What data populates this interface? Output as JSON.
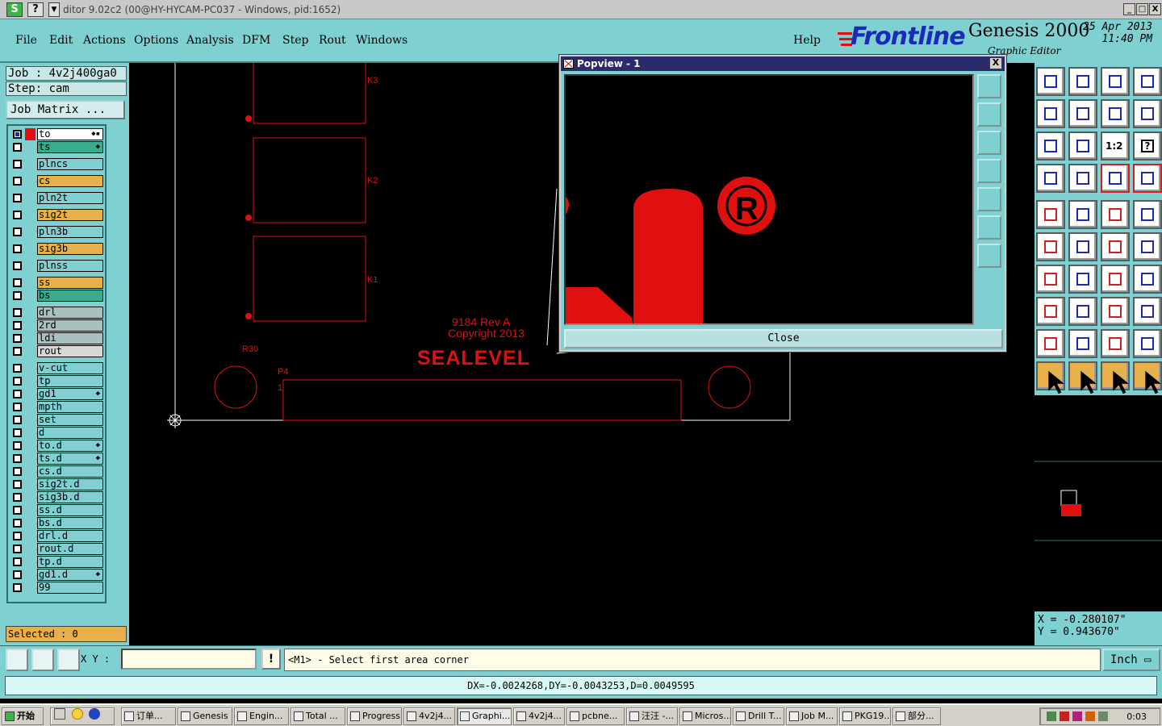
{
  "window": {
    "title": "ditor 9.02c2 (00@HY-HYCAM-PC037 - Windows, pid:1652)",
    "icon_label": "S",
    "help_glyph": "?",
    "min": "_",
    "max": "□",
    "close": "X"
  },
  "menu": {
    "items": [
      "File",
      "Edit",
      "Actions",
      "Options",
      "Analysis",
      "DFM",
      "Step",
      "Rout",
      "Windows"
    ],
    "help": "Help"
  },
  "brand": {
    "logo": "Frontline",
    "product": "Genesis 2000",
    "subtitle": "Graphic Editor",
    "date": "25 Apr 2013",
    "time": "11:40 PM"
  },
  "left": {
    "job": "Job : 4v2j400ga0",
    "step": "Step: cam",
    "job_matrix": "Job Matrix ...",
    "selected": "Selected : 0",
    "layers": [
      {
        "name": "to",
        "color": "#ffffff",
        "arrow": "◆▪",
        "red": true,
        "active": true
      },
      {
        "name": "ts",
        "color": "#3caa8c",
        "arrow": "◆"
      },
      {
        "name": "plncs",
        "color": "#7fd0d0"
      },
      {
        "name": "cs",
        "color": "#e8b04a"
      },
      {
        "name": "pln2t",
        "color": "#7fd0d0"
      },
      {
        "name": "sig2t",
        "color": "#e8b04a"
      },
      {
        "name": "pln3b",
        "color": "#7fd0d0"
      },
      {
        "name": "sig3b",
        "color": "#e8b04a"
      },
      {
        "name": "plnss",
        "color": "#7fd0d0"
      },
      {
        "name": "ss",
        "color": "#e8b04a"
      },
      {
        "name": "bs",
        "color": "#3caa8c"
      },
      {
        "name": "drl",
        "color": "#a8c0c0"
      },
      {
        "name": "2rd",
        "color": "#a8c0c0"
      },
      {
        "name": "ldi",
        "color": "#a8c0c0"
      },
      {
        "name": "rout",
        "color": "#d8d8d8"
      },
      {
        "name": "v-cut",
        "color": "#7fd0d0"
      },
      {
        "name": "tp",
        "color": "#7fd0d0"
      },
      {
        "name": "gd1",
        "color": "#7fd0d0",
        "arrow": "◆"
      },
      {
        "name": "mpth",
        "color": "#7fd0d0"
      },
      {
        "name": "set",
        "color": "#7fd0d0"
      },
      {
        "name": "d",
        "color": "#7fd0d0"
      },
      {
        "name": "to.d",
        "color": "#7fd0d0",
        "arrow": "◆"
      },
      {
        "name": "ts.d",
        "color": "#7fd0d0",
        "arrow": "◆"
      },
      {
        "name": "cs.d",
        "color": "#7fd0d0"
      },
      {
        "name": "sig2t.d",
        "color": "#7fd0d0"
      },
      {
        "name": "sig3b.d",
        "color": "#7fd0d0"
      },
      {
        "name": "ss.d",
        "color": "#7fd0d0"
      },
      {
        "name": "bs.d",
        "color": "#7fd0d0"
      },
      {
        "name": "drl.d",
        "color": "#7fd0d0"
      },
      {
        "name": "rout.d",
        "color": "#7fd0d0"
      },
      {
        "name": "tp.d",
        "color": "#7fd0d0"
      },
      {
        "name": "gd1.d",
        "color": "#7fd0d0",
        "arrow": "◆"
      },
      {
        "name": "99",
        "color": "#7fd0d0"
      }
    ]
  },
  "canvas": {
    "labels": {
      "k3": "K3",
      "k2": "K2",
      "k1": "K1",
      "r30": "R30",
      "p4": "P4",
      "pin1": "1",
      "rev": "9184 Rev A",
      "copyright": "Copyright 2013",
      "logo": "SEALEVEL"
    },
    "trace_color": "#e01010"
  },
  "popview": {
    "title": "Popview - 1",
    "close_label": "Close",
    "close_glyph": "X",
    "registered": "R"
  },
  "right": {
    "tool_1_2": "1:2",
    "tool_help": "?",
    "x": "X = -0.280107\"",
    "y": "Y = 0.943670\""
  },
  "cmd": {
    "xy_label": "X Y :",
    "xy_value": "",
    "excl": "!",
    "prompt": "<M1> - Select first area corner",
    "unit": "Inch ▭"
  },
  "status": {
    "text": "DX=-0.0024268,DY=-0.0043253,D=0.0049595"
  },
  "taskbar": {
    "start": "开始",
    "items": [
      {
        "label": "订单..."
      },
      {
        "label": "Genesis"
      },
      {
        "label": "Engin..."
      },
      {
        "label": "Total ..."
      },
      {
        "label": "Progress"
      },
      {
        "label": "4v2j4..."
      },
      {
        "label": "Graphi...",
        "active": true
      },
      {
        "label": "4v2j4..."
      },
      {
        "label": "pcbne..."
      },
      {
        "label": "汪汪 -..."
      },
      {
        "label": "Micros..."
      },
      {
        "label": "Drill T..."
      },
      {
        "label": "Job M..."
      },
      {
        "label": "PKG19..."
      },
      {
        "label": "部分..."
      }
    ],
    "time": "0:03"
  }
}
